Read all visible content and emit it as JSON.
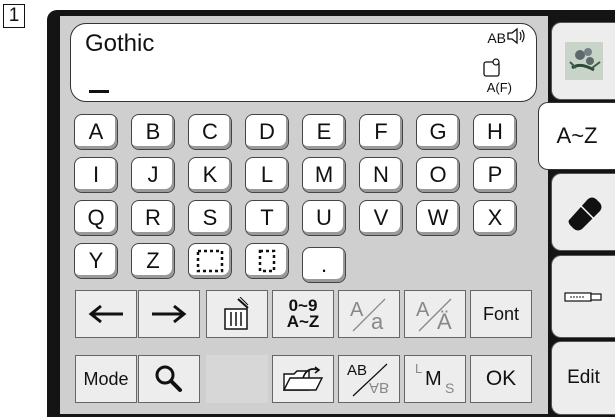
{
  "step_number": "1",
  "display": {
    "font_name": "Gothic",
    "case_label": "AB",
    "format_label": "A(F)",
    "icons": [
      "speaker-icon",
      "format-box-icon"
    ]
  },
  "keyboard": {
    "rows": [
      [
        "A",
        "B",
        "C",
        "D",
        "E",
        "F",
        "G",
        "H"
      ],
      [
        "I",
        "J",
        "K",
        "L",
        "M",
        "N",
        "O",
        "P"
      ],
      [
        "Q",
        "R",
        "S",
        "T",
        "U",
        "V",
        "W",
        "X"
      ],
      [
        "Y",
        "Z"
      ]
    ],
    "space_key_icons": [
      "wide-space-icon",
      "narrow-space-icon"
    ],
    "period": "."
  },
  "tools": {
    "row1": {
      "left_arrow_icon": "left-arrow-icon",
      "right_arrow_icon": "right-arrow-icon",
      "delete_icon": "delete-icon",
      "numbers_label_top": "0~9",
      "numbers_label_bottom": "A~Z",
      "size_small_top": "A",
      "size_small_bottom": "a",
      "accent_top": "A",
      "accent_bottom": "Ä",
      "font_label": "Font"
    },
    "row2": {
      "mode_label": "Mode",
      "zoom_icon": "magnifier-icon",
      "memory_icon": "folder-open-icon",
      "mirror_top": "AB",
      "mirror_bottom": "AB",
      "size_l": "L",
      "size_m": "M",
      "size_s": "S",
      "ok_label": "OK"
    }
  },
  "tabs": {
    "pattern_icon": "flower-pattern-icon",
    "alphabet_label": "A~Z",
    "eraser_icon": "eraser-icon",
    "usb_icon": "usb-stick-icon",
    "edit_label": "Edit"
  }
}
